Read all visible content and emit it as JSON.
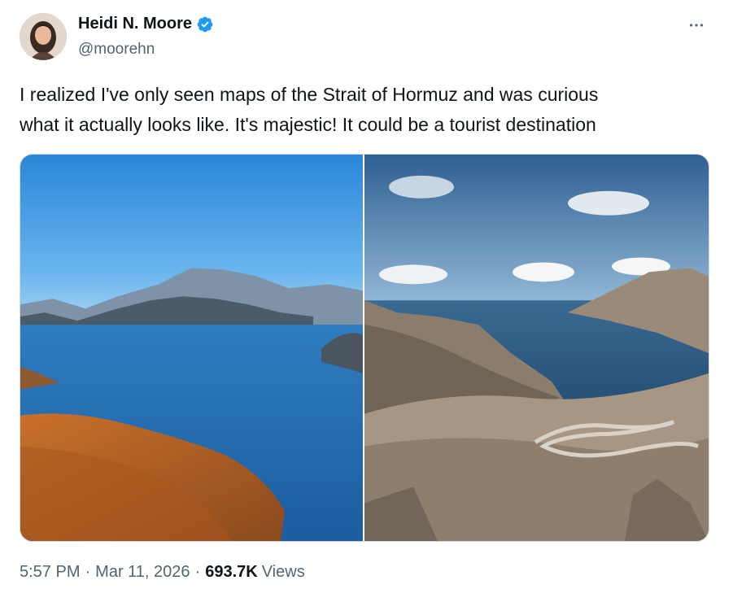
{
  "author": {
    "display_name": "Heidi N. Moore",
    "handle": "@moorehn",
    "verified": true
  },
  "tweet": {
    "text_line1": "I realized I've only seen maps of the Strait of Hormuz and was curious",
    "text_line2": "what it actually looks like. It's majestic! It could be a tourist destination"
  },
  "media": {
    "photo_count": 2
  },
  "meta": {
    "time": "5:57 PM",
    "separator": "·",
    "date": "Mar 11, 2026",
    "views_count": "693.7K",
    "views_label": "Views"
  },
  "colors": {
    "verified_blue": "#1d9bf0",
    "secondary_text": "#536471",
    "primary_text": "#0f1419"
  },
  "icons": {
    "verified": "verified-badge-icon",
    "more": "more-horizontal-icon"
  }
}
